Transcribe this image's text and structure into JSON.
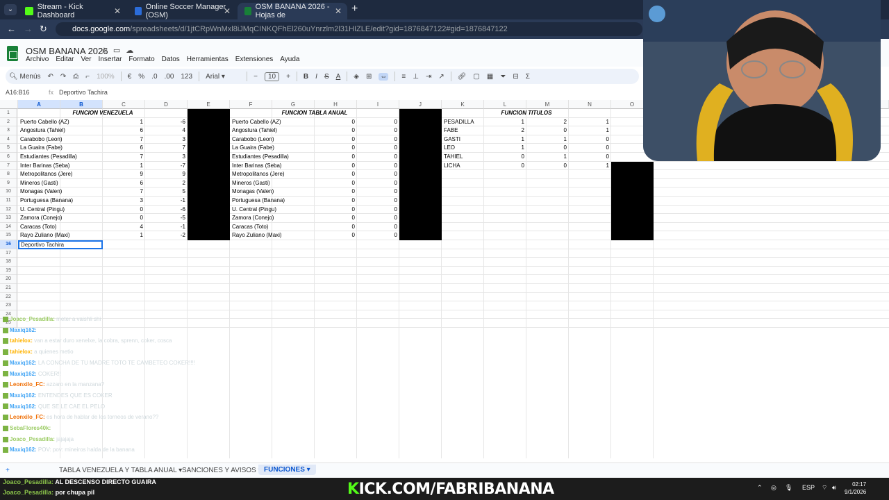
{
  "browser": {
    "tabs": [
      {
        "label": "Stream - Kick Dashboard",
        "color": "#53fc18"
      },
      {
        "label": "Online Soccer Manager (OSM)",
        "color": "#2b6cd9"
      },
      {
        "label": "OSM BANANA 2026 - Hojas de",
        "color": "#188038"
      }
    ],
    "url_host": "docs.google.com",
    "url_path": "/spreadsheets/d/1jtCRpWnMxl8iJMqCINKQFhEl260uYnrzlm2l31HIZLE/edit?gid=1876847122#gid=1876847122"
  },
  "sheets": {
    "doc_title": "OSM BANANA 2026",
    "menu": [
      "Archivo",
      "Editar",
      "Ver",
      "Insertar",
      "Formato",
      "Datos",
      "Herramientas",
      "Extensiones",
      "Ayuda"
    ],
    "toolbar": {
      "search": "Menús",
      "zoom": "100%",
      "currency": "€",
      "percent": "%",
      "dec_less": ".0",
      "dec_more": ".00",
      "number_format": "123",
      "font": "Arial",
      "font_size": "10"
    },
    "name_box": "A16:B16",
    "formula_value": "Deportivo Tachira",
    "columns": [
      "A",
      "B",
      "C",
      "D",
      "E",
      "F",
      "G",
      "H",
      "I",
      "J",
      "K",
      "L",
      "M",
      "N",
      "O"
    ],
    "rows": [
      "1",
      "2",
      "3",
      "4",
      "5",
      "6",
      "7",
      "8",
      "9",
      "10",
      "11",
      "12",
      "13",
      "14",
      "15",
      "16",
      "17",
      "18",
      "19",
      "20",
      "21",
      "22",
      "23",
      "24",
      "25"
    ],
    "funcion_venezuela": {
      "header": "FUNCION VENEZUELA",
      "rows": [
        {
          "name": "Puerto Cabello (AZ)",
          "c": "1",
          "d": "-6"
        },
        {
          "name": "Angostura (Tahiel)",
          "c": "6",
          "d": "4"
        },
        {
          "name": "Carabobo (Leon)",
          "c": "7",
          "d": "3"
        },
        {
          "name": "La Guaira (Fabe)",
          "c": "6",
          "d": "7"
        },
        {
          "name": "Estudiantes (Pesadilla)",
          "c": "7",
          "d": "3"
        },
        {
          "name": "Inter Barinas (Seba)",
          "c": "1",
          "d": "-7"
        },
        {
          "name": "Metropolitanos (Jere)",
          "c": "9",
          "d": "9"
        },
        {
          "name": "Mineros (Gasti)",
          "c": "6",
          "d": "2"
        },
        {
          "name": "Monagas (Valen)",
          "c": "7",
          "d": "5"
        },
        {
          "name": "Portuguesa (Banana)",
          "c": "3",
          "d": "-1"
        },
        {
          "name": "U. Central (Pingu)",
          "c": "0",
          "d": "-6"
        },
        {
          "name": "Zamora (Conejo)",
          "c": "0",
          "d": "-5"
        },
        {
          "name": "Caracas (Toto)",
          "c": "4",
          "d": "-1"
        },
        {
          "name": "Rayo Zuliano (Maxi)",
          "c": "1",
          "d": "-2"
        }
      ],
      "editing_cell": "Deportivo Tachira"
    },
    "funcion_tabla_anual": {
      "header": "FUNCION TABLA ANUAL",
      "rows": [
        {
          "name": "Puerto Cabello (AZ)",
          "h": "0",
          "i": "0"
        },
        {
          "name": "Angostura (Tahiel)",
          "h": "0",
          "i": "0"
        },
        {
          "name": "Carabobo (Leon)",
          "h": "0",
          "i": "0"
        },
        {
          "name": "La Guaira (Fabe)",
          "h": "0",
          "i": "0"
        },
        {
          "name": "Estudiantes (Pesadilla)",
          "h": "0",
          "i": "0"
        },
        {
          "name": "Inter Barinas (Seba)",
          "h": "0",
          "i": "0"
        },
        {
          "name": "Metropolitanos (Jere)",
          "h": "0",
          "i": "0"
        },
        {
          "name": "Mineros (Gasti)",
          "h": "0",
          "i": "0"
        },
        {
          "name": "Monagas (Valen)",
          "h": "0",
          "i": "0"
        },
        {
          "name": "Portuguesa (Banana)",
          "h": "0",
          "i": "0"
        },
        {
          "name": "U. Central (Pingu)",
          "h": "0",
          "i": "0"
        },
        {
          "name": "Zamora (Conejo)",
          "h": "0",
          "i": "0"
        },
        {
          "name": "Caracas (Toto)",
          "h": "0",
          "i": "0"
        },
        {
          "name": "Rayo Zuliano (Maxi)",
          "h": "0",
          "i": "0"
        }
      ]
    },
    "funcion_titulos": {
      "header": "FUNCION TITULOS",
      "rows": [
        {
          "name": "PESADILLA",
          "l": "1",
          "m": "2",
          "n": "1"
        },
        {
          "name": "FABE",
          "l": "2",
          "m": "0",
          "n": "1"
        },
        {
          "name": "GASTI",
          "l": "1",
          "m": "1",
          "n": "0"
        },
        {
          "name": "LEO",
          "l": "1",
          "m": "0",
          "n": "0"
        },
        {
          "name": "TAHIEL",
          "l": "0",
          "m": "1",
          "n": "0"
        },
        {
          "name": "LICHA",
          "l": "0",
          "m": "0",
          "n": "1"
        }
      ]
    },
    "sheet_tabs": [
      "TABLA VENEZUELA Y TABLA ANUAL",
      "SANCIONES Y AVISOS",
      "FUNCIONES"
    ]
  },
  "chat": [
    {
      "user": "Joaco_Pesadilla:",
      "msg": "meter a vaishli shi",
      "color": "#9ccc65"
    },
    {
      "user": "Maxiq162:",
      "msg": "",
      "color": "#42a5f5"
    },
    {
      "user": "tahielox:",
      "msg": "van a estar duro xenelxe, la cobra, sprenn, coker, cosca",
      "color": "#ffb300"
    },
    {
      "user": "tahielox:",
      "msg": "a quienes metio",
      "color": "#ffb300"
    },
    {
      "user": "Maxiq162:",
      "msg": "LA CONCHA DE TU MADRE TOTO TE CAMBETEO COKER!!!!",
      "color": "#42a5f5"
    },
    {
      "user": "Maxiq162:",
      "msg": "COKER!!",
      "color": "#42a5f5"
    },
    {
      "user": "Leonxilo_FC:",
      "msg": "azzaro en la manzana?",
      "color": "#ef6c00"
    },
    {
      "user": "Maxiq162:",
      "msg": "ENTENDES QUE ES COKER",
      "color": "#42a5f5"
    },
    {
      "user": "Maxiq162:",
      "msg": "QUE SE LE CAE EL PELO",
      "color": "#42a5f5"
    },
    {
      "user": "Leonxilo_FC:",
      "msg": "es hora de hablar de los torneos de verano??",
      "color": "#ef6c00"
    },
    {
      "user": "SebaFlores40k:",
      "msg": "",
      "color": "#9ccc65"
    },
    {
      "user": "Joaco_Pesadilla:",
      "msg": "jajajaja",
      "color": "#9ccc65"
    },
    {
      "user": "Maxiq162:",
      "msg": "POV: pov: mineiros halda de la banana",
      "color": "#42a5f5"
    }
  ],
  "bottom_chat": [
    {
      "user": "Joaco_Pesadilla:",
      "msg": "AL DESCENSO DIRECTO GUAIRA"
    },
    {
      "user": "Joaco_Pesadilla:",
      "msg": "por chupa pil"
    }
  ],
  "stream_banner": {
    "k": "K",
    "rest": "ICK.COM/FABRIBANANA"
  },
  "taskbar": {
    "lang": "ESP",
    "time": "02:17",
    "date": "9/1/2026"
  }
}
